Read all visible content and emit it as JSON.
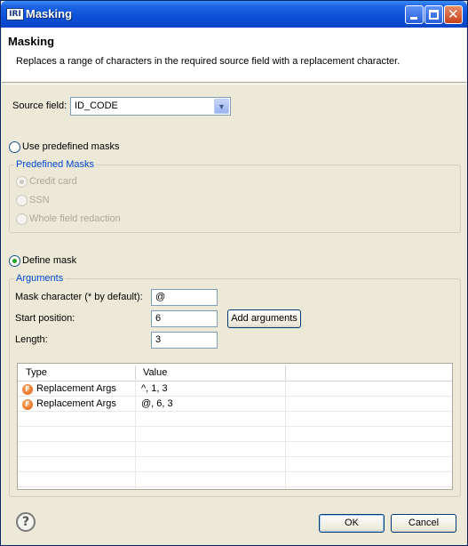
{
  "window": {
    "title": "Masking",
    "app_icon": "IRI"
  },
  "header": {
    "title": "Masking",
    "description": "Replaces a range of characters in the required source field with a replacement character."
  },
  "source_field": {
    "label": "Source field:",
    "value": "ID_CODE"
  },
  "predefined": {
    "radio_label": "Use predefined masks",
    "selected": false,
    "group_title": "Predefined Masks",
    "options": [
      {
        "label": "Credit card",
        "selected": true
      },
      {
        "label": "SSN",
        "selected": false
      },
      {
        "label": "Whole field redaction",
        "selected": false
      }
    ]
  },
  "define": {
    "radio_label": "Define mask",
    "selected": true,
    "group_title": "Arguments",
    "mask_char": {
      "label": "Mask character (* by default):",
      "value": "@"
    },
    "start_pos": {
      "label": "Start position:",
      "value": "6"
    },
    "length": {
      "label": "Length:",
      "value": "3"
    },
    "add_button": "Add arguments"
  },
  "table": {
    "columns": [
      "Type",
      "Value"
    ],
    "rows": [
      {
        "icon": "function-icon",
        "type": "Replacement Args",
        "value": "^, 1, 3"
      },
      {
        "icon": "function-icon",
        "type": "Replacement Args",
        "value": "@, 6, 3"
      }
    ]
  },
  "footer": {
    "ok": "OK",
    "cancel": "Cancel",
    "help_icon": "help-icon"
  }
}
